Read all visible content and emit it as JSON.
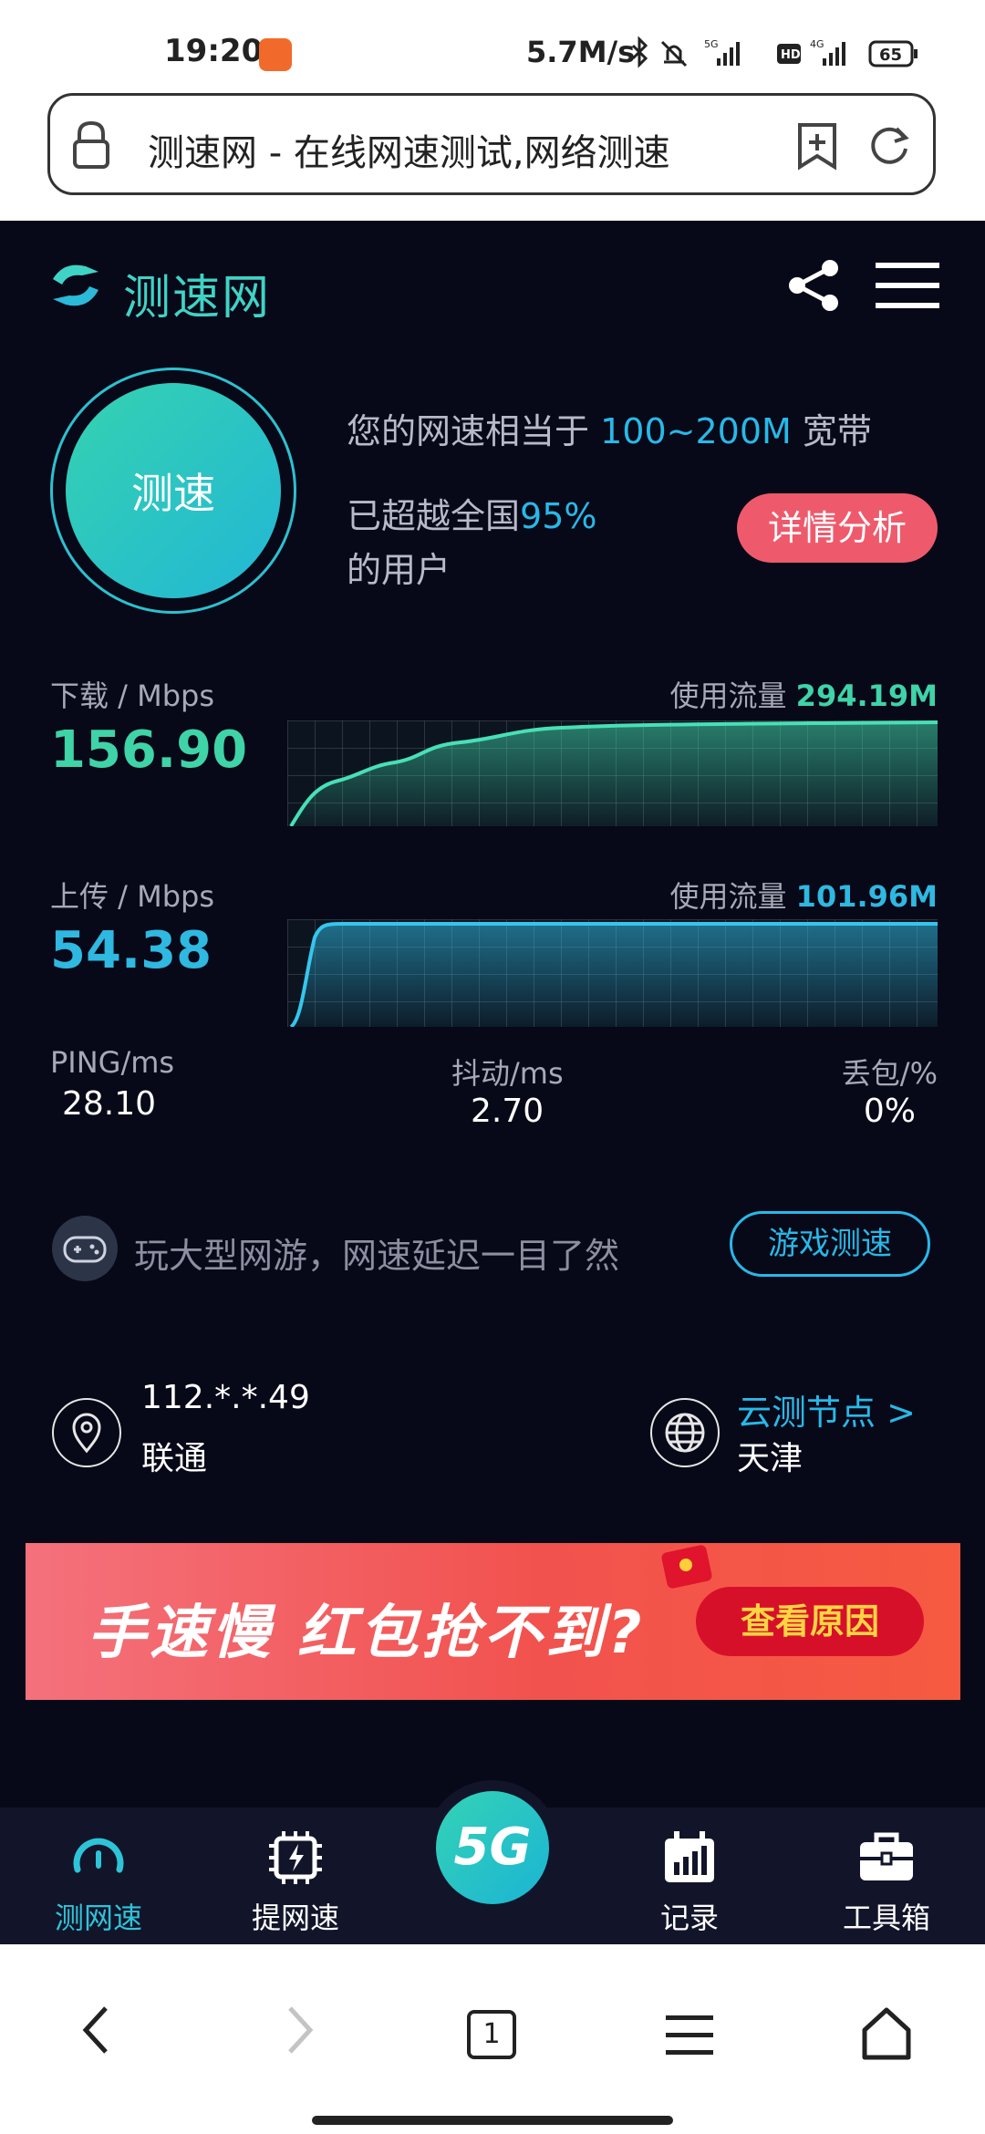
{
  "status_bar": {
    "time": "19:20",
    "net_speed": "5.7M/s",
    "signal1": "5G",
    "signal2": "4G",
    "hd": "HD",
    "battery": "65"
  },
  "browser": {
    "page_title": "测速网 - 在线网速测试,网络测速"
  },
  "header": {
    "logo_text": "测速网"
  },
  "speedtest": {
    "start_label": "测速",
    "summary_prefix": "您的网速相当于 ",
    "summary_value": "100~200M",
    "summary_suffix": " 宽带",
    "beat_prefix": "已超越全国",
    "beat_pct": "95%",
    "beat_suffix": "的用户",
    "detail_button": "详情分析"
  },
  "download": {
    "label": "下载 / Mbps",
    "value": "156.90",
    "usage_label": "使用流量",
    "usage_value": "294.19M",
    "color": "#3fd3a8"
  },
  "upload": {
    "label": "上传 / Mbps",
    "value": "54.38",
    "usage_label": "使用流量",
    "usage_value": "101.96M",
    "color": "#2fb8e0"
  },
  "stats": {
    "ping_label": "PING/ms",
    "ping_value": "28.10",
    "jitter_label": "抖动/ms",
    "jitter_value": "2.70",
    "loss_label": "丢包/%",
    "loss_value": "0%"
  },
  "game": {
    "text": "玩大型网游，网速延迟一目了然",
    "button": "游戏测速"
  },
  "connection": {
    "ip": "112.*.*.49",
    "isp": "联通",
    "node_label": "云测节点 >",
    "node_city": "天津"
  },
  "banner": {
    "text": "手速慢 红包抢不到?",
    "button": "查看原因"
  },
  "tabs": [
    {
      "label": "测网速",
      "icon": "speedometer-icon",
      "active": true
    },
    {
      "label": "提网速",
      "icon": "chip-icon",
      "active": false
    },
    {
      "label": "5G",
      "icon": "5g-icon",
      "active": false
    },
    {
      "label": "记录",
      "icon": "records-icon",
      "active": false
    },
    {
      "label": "工具箱",
      "icon": "toolbox-icon",
      "active": false
    }
  ],
  "nav": {
    "tab_count": "1"
  },
  "colors": {
    "accent": "#27b9e8",
    "teal": "#3fd3a8",
    "danger": "#ee5a6c",
    "background": "#070818"
  }
}
